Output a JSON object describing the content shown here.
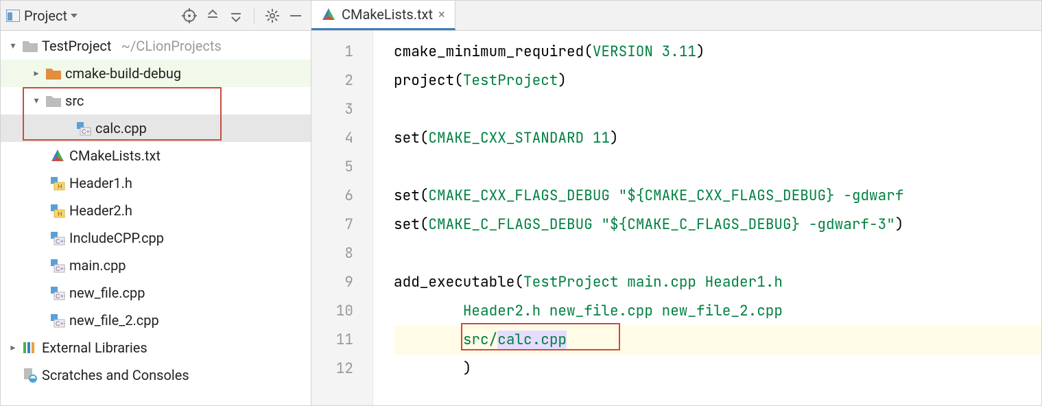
{
  "projectHeader": {
    "title": "Project"
  },
  "tree": {
    "root": {
      "name": "TestProject",
      "pathHint": "~/CLionProjects"
    },
    "cmakeBuild": "cmake-build-debug",
    "srcFolder": "src",
    "srcFile": "calc.cpp",
    "files": {
      "cmakelists": "CMakeLists.txt",
      "header1": "Header1.h",
      "header2": "Header2.h",
      "includecpp": "IncludeCPP.cpp",
      "main": "main.cpp",
      "newfile": "new_file.cpp",
      "newfile2": "new_file_2.cpp"
    },
    "external": "External Libraries",
    "scratches": "Scratches and Consoles"
  },
  "tab": {
    "label": "CMakeLists.txt"
  },
  "code": {
    "l1": {
      "fn": "cmake_minimum_required",
      "a1": "VERSION",
      "a2": "3.11"
    },
    "l2": {
      "fn": "project",
      "a1": "TestProject"
    },
    "l4": {
      "fn": "set",
      "a1": "CMAKE_CXX_STANDARD",
      "a2": "11"
    },
    "l6": {
      "fn": "set",
      "a1": "CMAKE_CXX_FLAGS_DEBUG",
      "s": "\"${CMAKE_CXX_FLAGS_DEBUG} -gdwarf"
    },
    "l7": {
      "fn": "set",
      "a1": "CMAKE_C_FLAGS_DEBUG",
      "s": "\"${CMAKE_C_FLAGS_DEBUG} -gdwarf-3\"",
      "close": ")"
    },
    "l9": {
      "fn": "add_executable",
      "args": "TestProject main.cpp Header1.h"
    },
    "l10": {
      "args": "Header2.h new_file.cpp new_file_2.cpp"
    },
    "l11": {
      "pre": "src/",
      "sel": "calc.cpp"
    },
    "l12": {
      "close": ")"
    }
  },
  "lineNumbers": [
    "1",
    "2",
    "3",
    "4",
    "5",
    "6",
    "7",
    "8",
    "9",
    "10",
    "11",
    "12"
  ]
}
